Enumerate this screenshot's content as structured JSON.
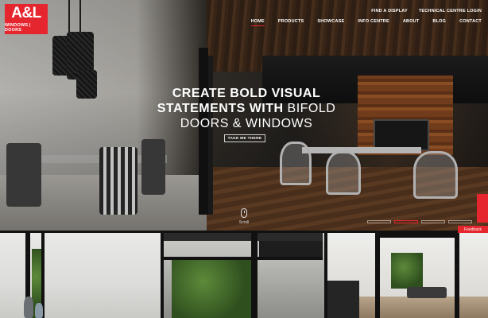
{
  "brand": {
    "logo_main": "A&L",
    "logo_sub": "WINDOWS | DOORS",
    "accent_color": "#e5262e"
  },
  "top_links": [
    "FIND A DISPLAY",
    "TECHNICAL CENTRE LOGIN"
  ],
  "nav": {
    "items": [
      "HOME",
      "PRODUCTS",
      "SHOWCASE",
      "INFO CENTRE",
      "ABOUT",
      "BLOG",
      "CONTACT"
    ],
    "active": "HOME"
  },
  "hero": {
    "headline_line1": "CREATE BOLD VISUAL",
    "headline_line2_bold": "STATEMENTS WITH",
    "headline_line2_rest": " BIFOLD",
    "headline_line3": "DOORS & WINDOWS",
    "cta_label": "TAKE ME THERE",
    "scroll_label": "Scroll",
    "slide_count": 4,
    "active_slide": 2
  },
  "feedback_label": "Feedback",
  "icons": {
    "scroll": "mouse-icon"
  }
}
